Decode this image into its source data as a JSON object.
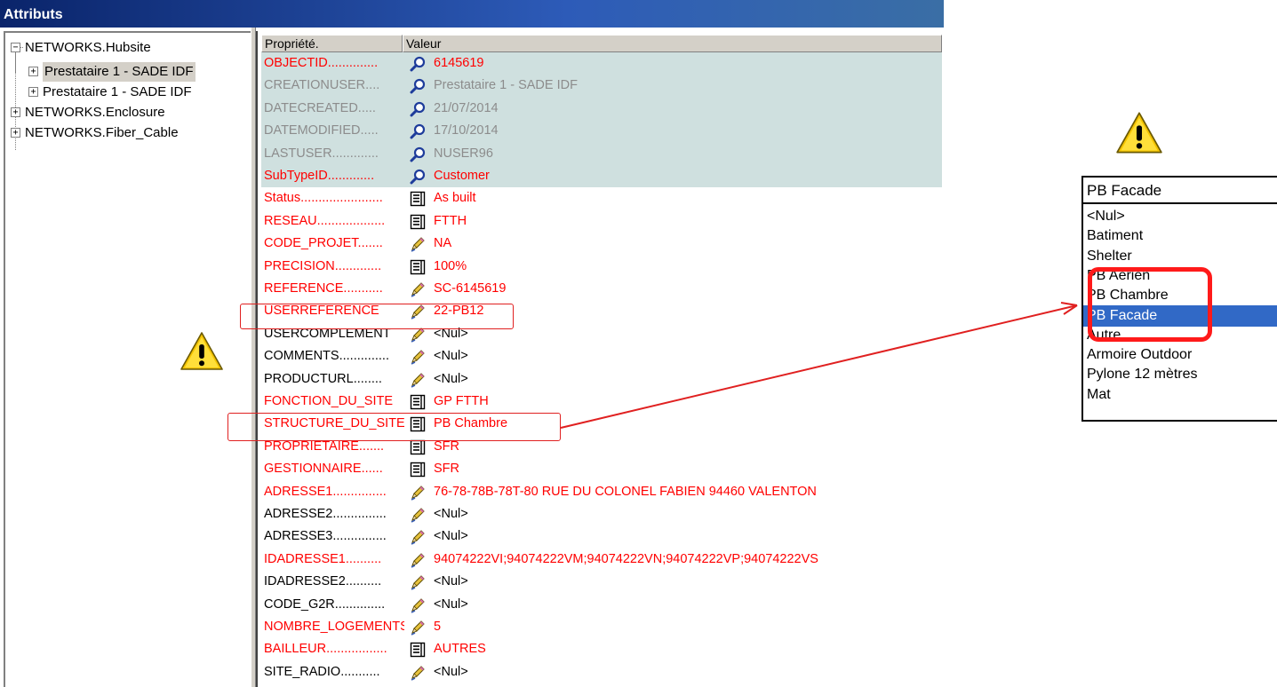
{
  "window": {
    "title": "Attributs"
  },
  "tree": {
    "nodes": [
      {
        "label": "NETWORKS.Hubsite",
        "toggle": "−"
      },
      {
        "label": "Prestataire 1 - SADE IDF",
        "toggle": "+"
      },
      {
        "label": "Prestataire 1 - SADE IDF",
        "toggle": "+"
      },
      {
        "label": "NETWORKS.Enclosure",
        "toggle": "+"
      },
      {
        "label": "NETWORKS.Fiber_Cable",
        "toggle": "+"
      }
    ]
  },
  "grid": {
    "columns": [
      "Propriété.",
      "Valeur"
    ],
    "rows": [
      {
        "prop": "OBJECTID..............",
        "value": "6145619",
        "icon": "magnifier-icon",
        "style": "req",
        "readonly": true
      },
      {
        "prop": "CREATIONUSER....",
        "value": "Prestataire 1 - SADE IDF",
        "icon": "magnifier-icon",
        "style": "gray",
        "readonly": true
      },
      {
        "prop": "DATECREATED.....",
        "value": "21/07/2014",
        "icon": "magnifier-icon",
        "style": "gray",
        "readonly": true
      },
      {
        "prop": "DATEMODIFIED.....",
        "value": "17/10/2014",
        "icon": "magnifier-icon",
        "style": "gray",
        "readonly": true
      },
      {
        "prop": "LASTUSER.............",
        "value": "NUSER96",
        "icon": "magnifier-icon",
        "style": "gray",
        "readonly": true
      },
      {
        "prop": "SubTypeID.............",
        "value": "Customer",
        "icon": "magnifier-icon",
        "style": "req",
        "readonly": true
      },
      {
        "prop": "Status.......................",
        "value": "As built",
        "icon": "list-icon",
        "style": "req",
        "readonly": false
      },
      {
        "prop": "RESEAU...................",
        "value": "FTTH",
        "icon": "list-icon",
        "style": "req",
        "readonly": false
      },
      {
        "prop": "CODE_PROJET.......",
        "value": "NA",
        "icon": "pencil-icon",
        "style": "req",
        "readonly": false
      },
      {
        "prop": "PRECISION.............",
        "value": "100%",
        "icon": "list-icon",
        "style": "req",
        "readonly": false
      },
      {
        "prop": "REFERENCE...........",
        "value": "SC-6145619",
        "icon": "pencil-icon",
        "style": "req",
        "readonly": false
      },
      {
        "prop": "USERREFERENCE",
        "value": "22-PB12",
        "icon": "pencil-icon",
        "style": "req",
        "readonly": false
      },
      {
        "prop": "USERCOMPLEMENT",
        "value": "<Nul>",
        "icon": "pencil-icon",
        "style": "opt",
        "readonly": false
      },
      {
        "prop": "COMMENTS..............",
        "value": "<Nul>",
        "icon": "pencil-icon",
        "style": "opt",
        "readonly": false
      },
      {
        "prop": "PRODUCTURL........",
        "value": "<Nul>",
        "icon": "pencil-icon",
        "style": "opt",
        "readonly": false
      },
      {
        "prop": "FONCTION_DU_SITE",
        "value": "GP FTTH",
        "icon": "list-icon",
        "style": "req",
        "readonly": false
      },
      {
        "prop": "STRUCTURE_DU_SITE",
        "value": "PB Chambre",
        "icon": "list-icon",
        "style": "req",
        "readonly": false
      },
      {
        "prop": "PROPRIETAIRE.......",
        "value": "SFR",
        "icon": "list-icon",
        "style": "req",
        "readonly": false
      },
      {
        "prop": "GESTIONNAIRE......",
        "value": "SFR",
        "icon": "list-icon",
        "style": "req",
        "readonly": false
      },
      {
        "prop": "ADRESSE1...............",
        "value": "76-78-78B-78T-80 RUE DU COLONEL FABIEN  94460 VALENTON",
        "icon": "pencil-icon",
        "style": "req",
        "readonly": false
      },
      {
        "prop": "ADRESSE2...............",
        "value": "<Nul>",
        "icon": "pencil-icon",
        "style": "opt",
        "readonly": false
      },
      {
        "prop": "ADRESSE3...............",
        "value": "<Nul>",
        "icon": "pencil-icon",
        "style": "opt",
        "readonly": false
      },
      {
        "prop": "IDADRESSE1..........",
        "value": "94074222VI;94074222VM;94074222VN;94074222VP;94074222VS",
        "icon": "pencil-icon",
        "style": "req",
        "readonly": false
      },
      {
        "prop": "IDADRESSE2..........",
        "value": "<Nul>",
        "icon": "pencil-icon",
        "style": "opt",
        "readonly": false
      },
      {
        "prop": "CODE_G2R..............",
        "value": "<Nul>",
        "icon": "pencil-icon",
        "style": "opt",
        "readonly": false
      },
      {
        "prop": "NOMBRE_LOGEMENTS",
        "value": "5",
        "icon": "pencil-icon",
        "style": "req",
        "readonly": false
      },
      {
        "prop": "BAILLEUR.................",
        "value": "AUTRES",
        "icon": "list-icon",
        "style": "req",
        "readonly": false
      },
      {
        "prop": "SITE_RADIO...........",
        "value": "<Nul>",
        "icon": "pencil-icon",
        "style": "opt",
        "readonly": false
      }
    ]
  },
  "dropdown": {
    "current_value": "PB Facade",
    "options": [
      "<Nul>",
      "Batiment",
      "Shelter",
      "PB Aerien",
      "PB Chambre",
      "PB Facade",
      "Autre",
      "Armoire Outdoor",
      "Pylone 12 mètres",
      "Mat"
    ],
    "selected_index": 5
  },
  "colors": {
    "required": "#ff0000",
    "readonly_row_bg": "#cfe0df",
    "highlight": "#e02020",
    "selection": "#3169c6"
  }
}
